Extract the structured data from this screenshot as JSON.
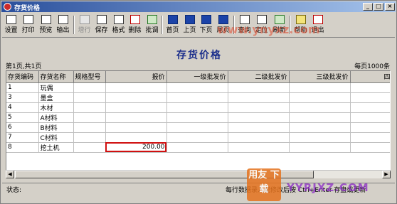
{
  "window": {
    "title": "存货价格"
  },
  "toolbar": {
    "buttons": [
      {
        "label": "设置",
        "icon": "settings-icon"
      },
      {
        "label": "打印",
        "icon": "print-icon"
      },
      {
        "label": "预览",
        "icon": "preview-icon"
      },
      {
        "label": "输出",
        "icon": "export-icon"
      },
      {
        "label": "增行",
        "icon": "add-row-icon",
        "disabled": true
      },
      {
        "label": "保存",
        "icon": "save-icon"
      },
      {
        "label": "格式",
        "icon": "format-icon"
      },
      {
        "label": "删除",
        "icon": "delete-icon"
      },
      {
        "label": "批调",
        "icon": "batch-adjust-icon"
      },
      {
        "label": "首页",
        "icon": "first-page-icon"
      },
      {
        "label": "上页",
        "icon": "prev-page-icon"
      },
      {
        "label": "下页",
        "icon": "next-page-icon"
      },
      {
        "label": "尾页",
        "icon": "last-page-icon"
      },
      {
        "label": "查询",
        "icon": "query-icon"
      },
      {
        "label": "定位",
        "icon": "locate-icon"
      },
      {
        "label": "刷新",
        "icon": "refresh-icon"
      },
      {
        "label": "帮助",
        "icon": "help-icon"
      },
      {
        "label": "退出",
        "icon": "exit-icon"
      }
    ]
  },
  "heading": "存货价格",
  "pageinfo": "第1页,共1页",
  "perpage": "每页1000条",
  "table": {
    "columns": [
      "存货编码",
      "存货名称",
      "规格型号",
      "报价",
      "一级批发价",
      "二级批发价",
      "三级批发价",
      "四级"
    ],
    "rows": [
      {
        "code": "1",
        "name": "玩偶",
        "spec": "",
        "price": ""
      },
      {
        "code": "3",
        "name": "墨盒",
        "spec": "",
        "price": ""
      },
      {
        "code": "4",
        "name": "木材",
        "spec": "",
        "price": ""
      },
      {
        "code": "5",
        "name": "A材料",
        "spec": "",
        "price": ""
      },
      {
        "code": "6",
        "name": "B材料",
        "spec": "",
        "price": ""
      },
      {
        "code": "7",
        "name": "C材料",
        "spec": "",
        "price": ""
      },
      {
        "code": "8",
        "name": "挖土机",
        "spec": "",
        "price": "200.00"
      }
    ]
  },
  "status": {
    "label": "状态:",
    "hint": "每行数据录入或修改后按 Ctrl+Enter 存盘或更新"
  },
  "watermarks": {
    "url": "www.ynyxz.com",
    "logo": "用友 下载",
    "site": "YYRJXZ.COM"
  }
}
